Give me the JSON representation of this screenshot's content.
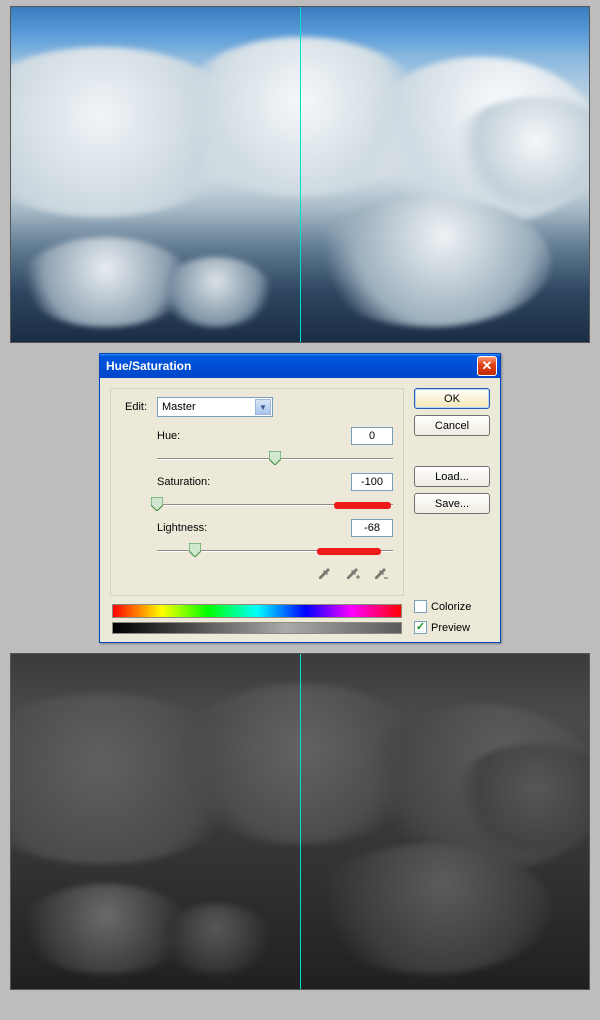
{
  "dialog": {
    "title": "Hue/Saturation",
    "edit_label": "Edit:",
    "edit_value": "Master",
    "sliders": {
      "hue": {
        "label": "Hue:",
        "value": "0",
        "pos_pct": 50,
        "highlight": false
      },
      "saturation": {
        "label": "Saturation:",
        "value": "-100",
        "pos_pct": 0,
        "highlight": true,
        "hl_left_pct": 75,
        "hl_width_pct": 24
      },
      "lightness": {
        "label": "Lightness:",
        "value": "-68",
        "pos_pct": 16,
        "highlight": true,
        "hl_left_pct": 68,
        "hl_width_pct": 27
      }
    },
    "buttons": {
      "ok": "OK",
      "cancel": "Cancel",
      "load": "Load...",
      "save": "Save..."
    },
    "checks": {
      "colorize": {
        "label": "Colorize",
        "checked": false
      },
      "preview": {
        "label": "Preview",
        "checked": true
      }
    }
  }
}
